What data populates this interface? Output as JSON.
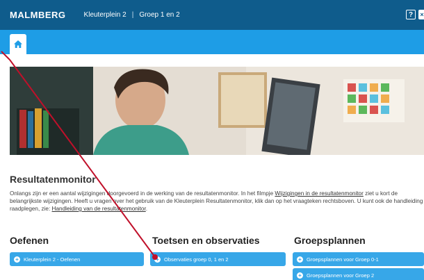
{
  "header": {
    "logo": "MALMBERG",
    "breadcrumb": [
      "Kleuterplein 2",
      "Groep 1 en 2"
    ],
    "breadcrumb_separator": "|",
    "help_label": "?",
    "close_label": "×",
    "bg_color": "#0f5c8c"
  },
  "nav": {
    "bg_color": "#1e9de6"
  },
  "main": {
    "title": "Resultatenmonitor",
    "intro_part1": "Onlangs zijn er een aantal wijzigingen doorgevoerd in de werking van de resultatenmonitor. In het filmpje ",
    "intro_link1": "Wijzigingen in de resultatenmonitor",
    "intro_part2": " ziet u kort de belangrijkste wijzigingen. Heeft u vragen over het gebruik van de Kleuterplein Resultatenmonitor, klik dan op het vraagteken rechtsboven. U kunt ook de handleiding raadplegen, zie: ",
    "intro_link2": "Handleiding van de resultatenmonitor",
    "intro_part3": "."
  },
  "columns": {
    "oefenen": {
      "title": "Oefenen",
      "buttons": [
        "Kleuterplein 2 - Oefenen"
      ]
    },
    "toetsen": {
      "title": "Toetsen en observaties",
      "buttons": [
        "Observaties groep 0, 1 en 2"
      ]
    },
    "groepsplannen": {
      "title": "Groepsplannen",
      "buttons": [
        "Groepsplannen voor Groep 0-1",
        "Groepsplannen voor Groep 2"
      ]
    }
  },
  "colors": {
    "button": "#37a7e8",
    "pointer": "#c0102a"
  }
}
